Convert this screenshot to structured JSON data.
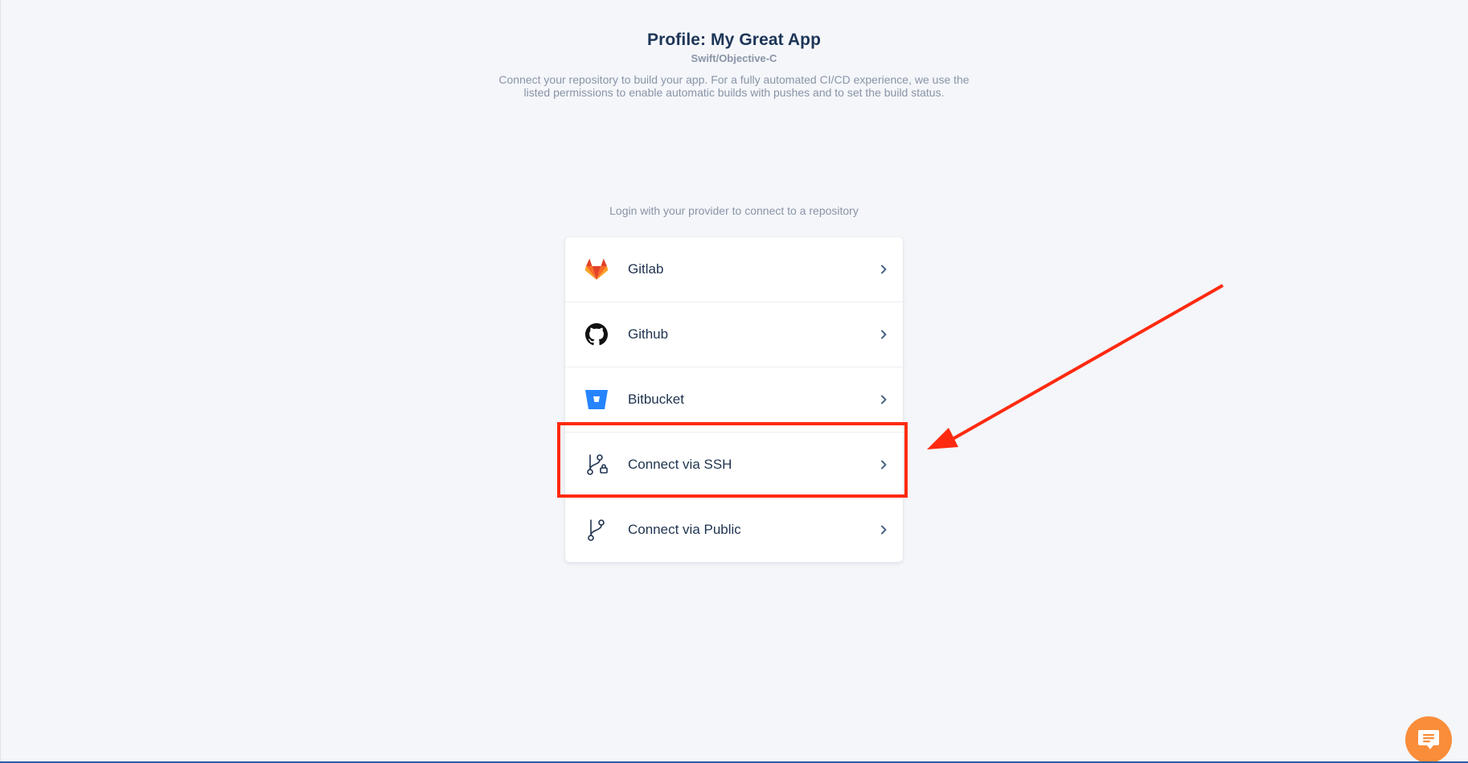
{
  "header": {
    "title": "Profile: My Great App",
    "subtitle": "Swift/Objective-C",
    "description": "Connect your repository to build your app. For a fully automated CI/CD experience, we use the listed permissions to enable automatic builds with pushes and to set the build status."
  },
  "providers": {
    "prompt": "Login with your provider to connect to a repository",
    "items": [
      {
        "label": "Gitlab",
        "icon": "gitlab-icon"
      },
      {
        "label": "Github",
        "icon": "github-icon"
      },
      {
        "label": "Bitbucket",
        "icon": "bitbucket-icon"
      },
      {
        "label": "Connect via SSH",
        "icon": "git-branch-lock-icon"
      },
      {
        "label": "Connect via Public",
        "icon": "git-branch-icon"
      }
    ]
  },
  "annotation": {
    "highlighted_item": "Connect via SSH",
    "color": "#ff2a10"
  },
  "chat": {
    "icon": "chat-icon",
    "color": "#f98d3a"
  },
  "colors": {
    "background": "#f4f6fa",
    "title": "#1d3557",
    "muted_text": "#8a94a6",
    "bitbucket": "#2684ff"
  }
}
